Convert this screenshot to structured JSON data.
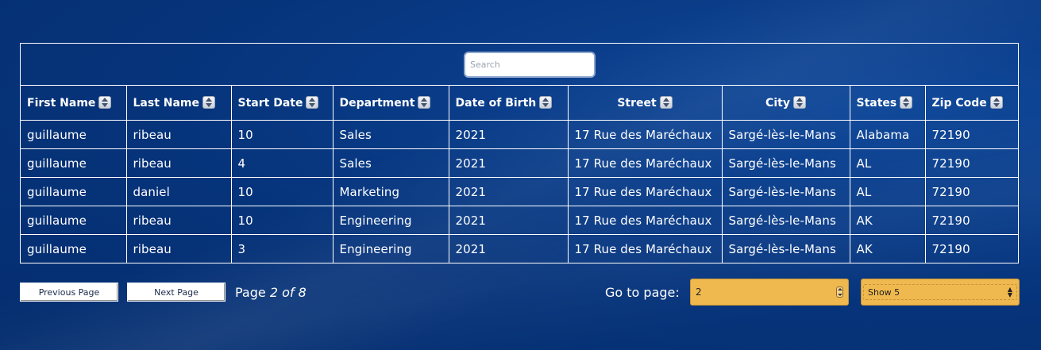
{
  "search": {
    "placeholder": "Search"
  },
  "table": {
    "columns": [
      "First Name",
      "Last Name",
      "Start Date",
      "Department",
      "Date of Birth",
      "Street",
      "City",
      "States",
      "Zip Code"
    ],
    "rows": [
      [
        "guillaume",
        "ribeau",
        "10",
        "Sales",
        "2021",
        "17 Rue des Maréchaux",
        "Sargé-lès-le-Mans",
        "Alabama",
        "72190"
      ],
      [
        "guillaume",
        "ribeau",
        "4",
        "Sales",
        "2021",
        "17 Rue des Maréchaux",
        "Sargé-lès-le-Mans",
        "AL",
        "72190"
      ],
      [
        "guillaume",
        "daniel",
        "10",
        "Marketing",
        "2021",
        "17 Rue des Maréchaux",
        "Sargé-lès-le-Mans",
        "AL",
        "72190"
      ],
      [
        "guillaume",
        "ribeau",
        "10",
        "Engineering",
        "2021",
        "17 Rue des Maréchaux",
        "Sargé-lès-le-Mans",
        "AK",
        "72190"
      ],
      [
        "guillaume",
        "ribeau",
        "3",
        "Engineering",
        "2021",
        "17 Rue des Maréchaux",
        "Sargé-lès-le-Mans",
        "AK",
        "72190"
      ]
    ]
  },
  "pagination": {
    "previous_label": "Previous Page",
    "next_label": "Next Page",
    "page_prefix": "Page ",
    "page_current": "2 of 8",
    "goto_label": "Go to page:",
    "goto_value": "2",
    "show_value": "Show 5"
  },
  "colors": {
    "background": "#06337a",
    "border": "#ffffff",
    "select_bg": "#f0b94f"
  }
}
